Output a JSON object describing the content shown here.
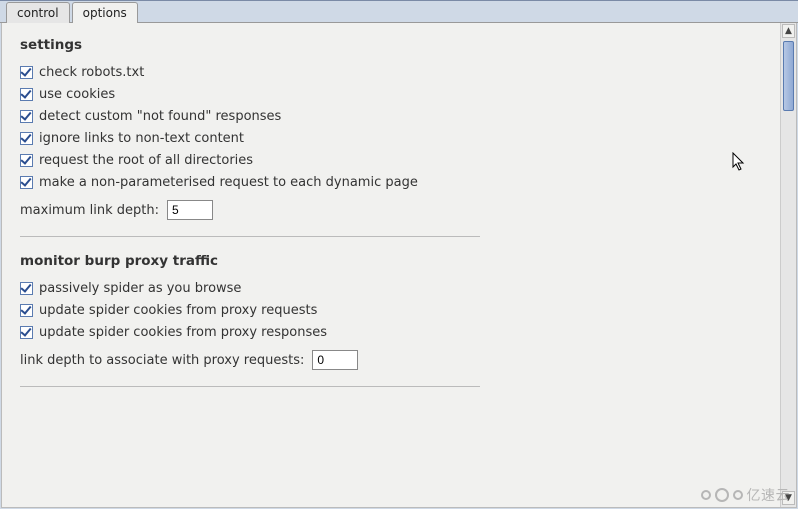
{
  "tabs": {
    "control": "control",
    "options": "options"
  },
  "settings": {
    "heading": "settings",
    "check_robots": {
      "label": "check robots.txt",
      "checked": true
    },
    "use_cookies": {
      "label": "use cookies",
      "checked": true
    },
    "detect_404": {
      "label": "detect custom \"not found\" responses",
      "checked": true
    },
    "ignore_nontext": {
      "label": "ignore links to non-text content",
      "checked": true
    },
    "request_root": {
      "label": "request the root of all directories",
      "checked": true
    },
    "nonparam_request": {
      "label": "make a non-parameterised request to each dynamic page",
      "checked": true
    },
    "max_depth_label": "maximum link depth:",
    "max_depth_value": "5"
  },
  "monitor": {
    "heading": "monitor burp proxy traffic",
    "passive_spider": {
      "label": "passively spider as you browse",
      "checked": true
    },
    "update_from_requests": {
      "label": "update spider cookies from proxy requests",
      "checked": true
    },
    "update_from_responses": {
      "label": "update spider cookies from proxy responses",
      "checked": true
    },
    "proxy_depth_label": "link depth to associate with proxy requests:",
    "proxy_depth_value": "0"
  },
  "watermark": "亿速云"
}
